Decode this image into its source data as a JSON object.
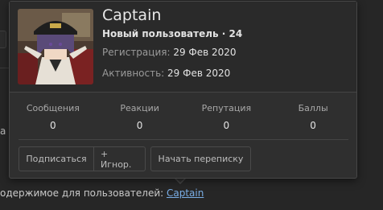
{
  "background": {
    "partial_text": "а",
    "bottom_prefix": "одержимое для пользователей: ",
    "bottom_link": "Captain"
  },
  "profile": {
    "name": "Captain",
    "role_line": "Новый пользователь · 24",
    "registration_label": "Регистрация: ",
    "registration_value": "29 Фев 2020",
    "activity_label": "Активность: ",
    "activity_value": "29 Фев 2020"
  },
  "stats": [
    {
      "label": "Сообщения",
      "value": "0"
    },
    {
      "label": "Реакции",
      "value": "0"
    },
    {
      "label": "Репутация",
      "value": "0"
    },
    {
      "label": "Баллы",
      "value": "0"
    }
  ],
  "actions": {
    "follow": "Подписаться",
    "ignore": "+ Игнор.",
    "message": "Начать переписку"
  },
  "colors": {
    "page_bg": "#262626",
    "card_bg": "#2f2f2f",
    "link": "#7aaee6"
  }
}
